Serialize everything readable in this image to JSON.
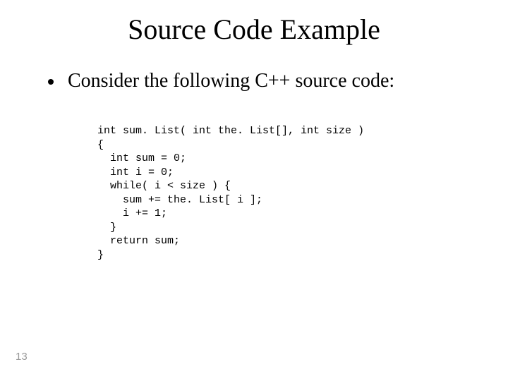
{
  "title": "Source Code Example",
  "bullet": "Consider the following C++ source code:",
  "code": "int sum. List( int the. List[], int size )\n{\n  int sum = 0;\n  int i = 0;\n  while( i < size ) {\n    sum += the. List[ i ];\n    i += 1;\n  }\n  return sum;\n}",
  "page_number": "13"
}
